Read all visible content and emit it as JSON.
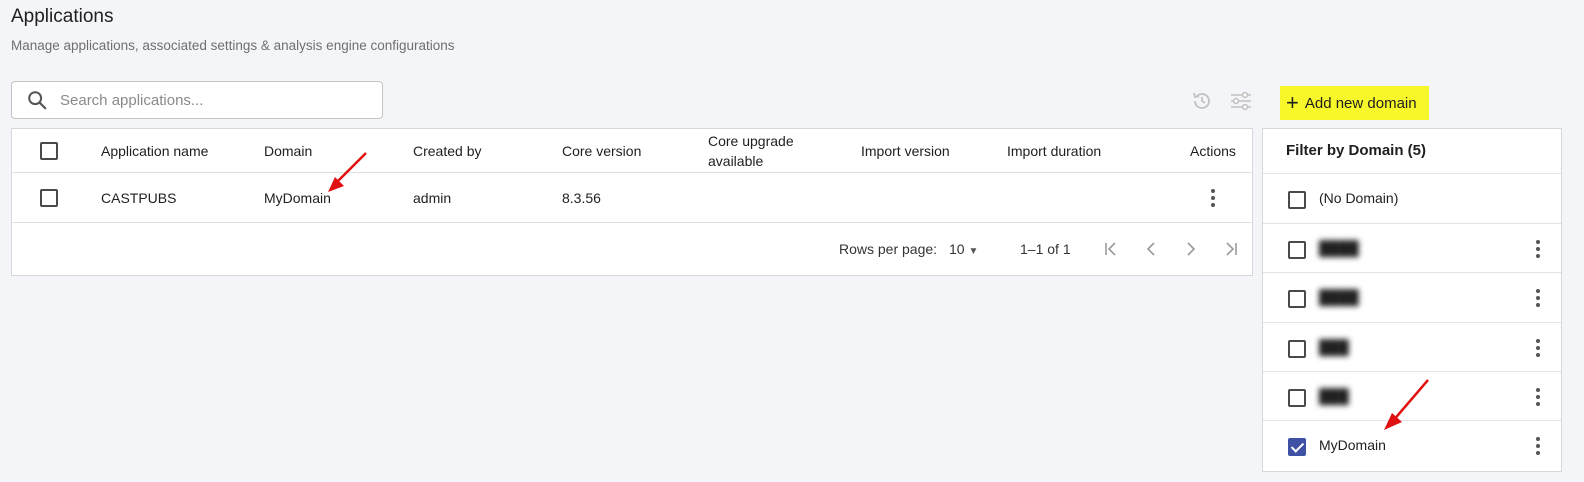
{
  "header": {
    "title": "Applications",
    "subtitle": "Manage applications, associated settings & analysis engine configurations"
  },
  "search": {
    "placeholder": "Search applications..."
  },
  "toolbar": {
    "refresh_icon": "history-icon",
    "settings_icon": "sliders-icon",
    "add_domain_label": "Add new domain",
    "add_domain_color": "#f7f72a"
  },
  "table": {
    "columns": [
      "Application name",
      "Domain",
      "Created by",
      "Core version",
      "Core upgrade available",
      "Import version",
      "Import duration",
      "Actions"
    ],
    "rows": [
      {
        "name": "CASTPUBS",
        "domain": "MyDomain",
        "created_by": "admin",
        "core_version": "8.3.56",
        "core_upgrade": "",
        "import_version": "",
        "import_duration": ""
      }
    ],
    "pagination": {
      "rows_per_page_label": "Rows per page:",
      "rows_per_page_value": "10",
      "range": "1–1 of 1"
    }
  },
  "filter": {
    "title": "Filter by Domain (5)",
    "items": [
      {
        "label": "(No Domain)",
        "checked": false,
        "redacted": false
      },
      {
        "label": "████",
        "checked": false,
        "redacted": true
      },
      {
        "label": "████",
        "checked": false,
        "redacted": true
      },
      {
        "label": "███",
        "checked": false,
        "redacted": true
      },
      {
        "label": "███",
        "checked": false,
        "redacted": true
      },
      {
        "label": "MyDomain",
        "checked": true,
        "redacted": false
      }
    ]
  },
  "colors": {
    "accent": "#3f51a5",
    "annotation_arrow": "#e01010"
  }
}
